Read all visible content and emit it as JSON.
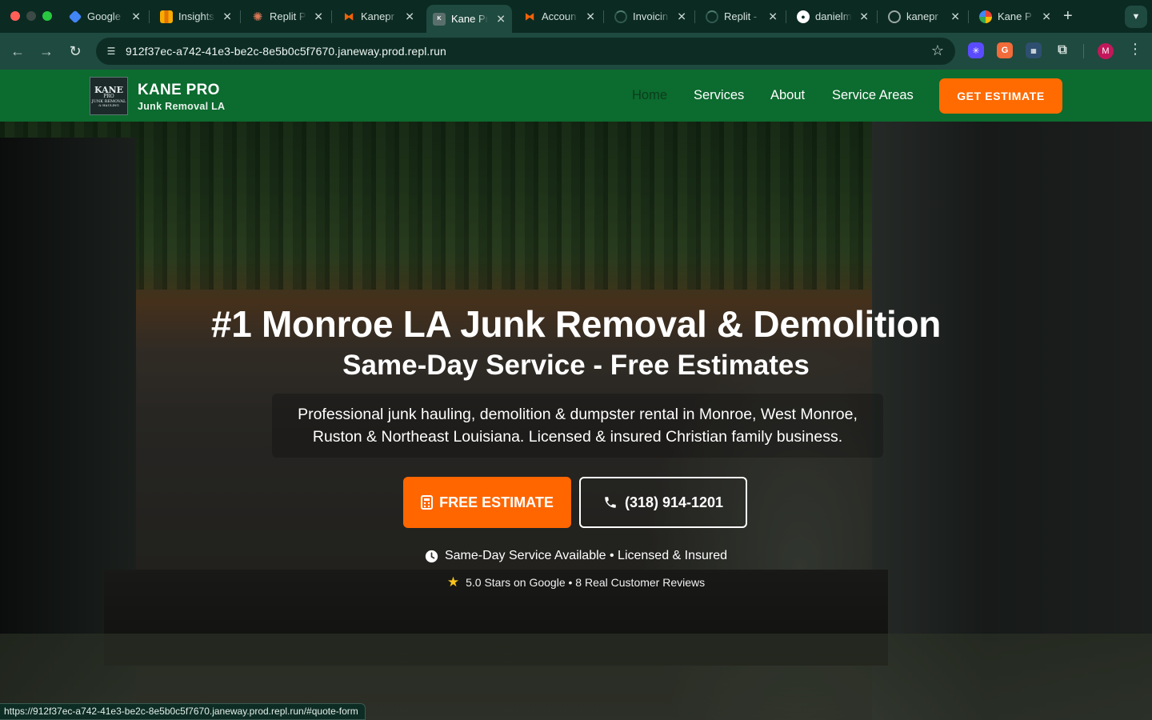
{
  "browser": {
    "tabs": [
      {
        "title": "Google",
        "icon": "google-ads-icon",
        "color": "#4285f4"
      },
      {
        "title": "Insights",
        "icon": "analytics-icon",
        "color": "#f9ab00"
      },
      {
        "title": "Replit P",
        "icon": "claude-icon",
        "color": "#d97757"
      },
      {
        "title": "Kanepr",
        "icon": "replit-icon",
        "color": "#f26207"
      },
      {
        "title": "Kane Pr",
        "icon": "kane-pro-icon",
        "color": "#5a6f6c",
        "active": true
      },
      {
        "title": "Accoun",
        "icon": "replit-icon",
        "color": "#f26207"
      },
      {
        "title": "Invoicin",
        "icon": "loading-icon",
        "color": "#1f4a3f"
      },
      {
        "title": "Replit -",
        "icon": "loading-icon",
        "color": "#1f4a3f"
      },
      {
        "title": "danielm",
        "icon": "github-icon",
        "color": "#ffffff"
      },
      {
        "title": "kanepr",
        "icon": "globe-icon",
        "color": "#9aa8a5"
      },
      {
        "title": "Kane P",
        "icon": "google-icon",
        "color": "#ffffff"
      }
    ],
    "url": "912f37ec-a742-41e3-be2c-8e5b0c5f7670.janeway.prod.repl.run",
    "profile_initial": "M",
    "status_url": "https://912f37ec-a742-41e3-be2c-8e5b0c5f7670.janeway.prod.repl.run/#quote-form"
  },
  "site": {
    "logo_lines": [
      "KANE",
      "PRO",
      "JUNK REMOVAL",
      "& HAULING"
    ],
    "brand_name": "KANE PRO",
    "brand_sub": "Junk Removal LA",
    "nav": [
      "Home",
      "Services",
      "About",
      "Service Areas"
    ],
    "header_cta": "GET ESTIMATE",
    "colors": {
      "brand_green": "#0c6b2f",
      "accent_orange": "#ff6600"
    }
  },
  "hero": {
    "title": "#1 Monroe LA Junk Removal & Demolition",
    "subtitle": "Same-Day Service - Free Estimates",
    "description": "Professional junk hauling, demolition & dumpster rental in Monroe, West Monroe, Ruston & Northeast Louisiana. Licensed & insured Christian family business.",
    "primary_cta": "FREE ESTIMATE",
    "phone_cta": "(318) 914-1201",
    "badges": "Same-Day Service Available • Licensed & Insured",
    "rating": "5.0 Stars on Google • 8 Real Customer Reviews"
  }
}
